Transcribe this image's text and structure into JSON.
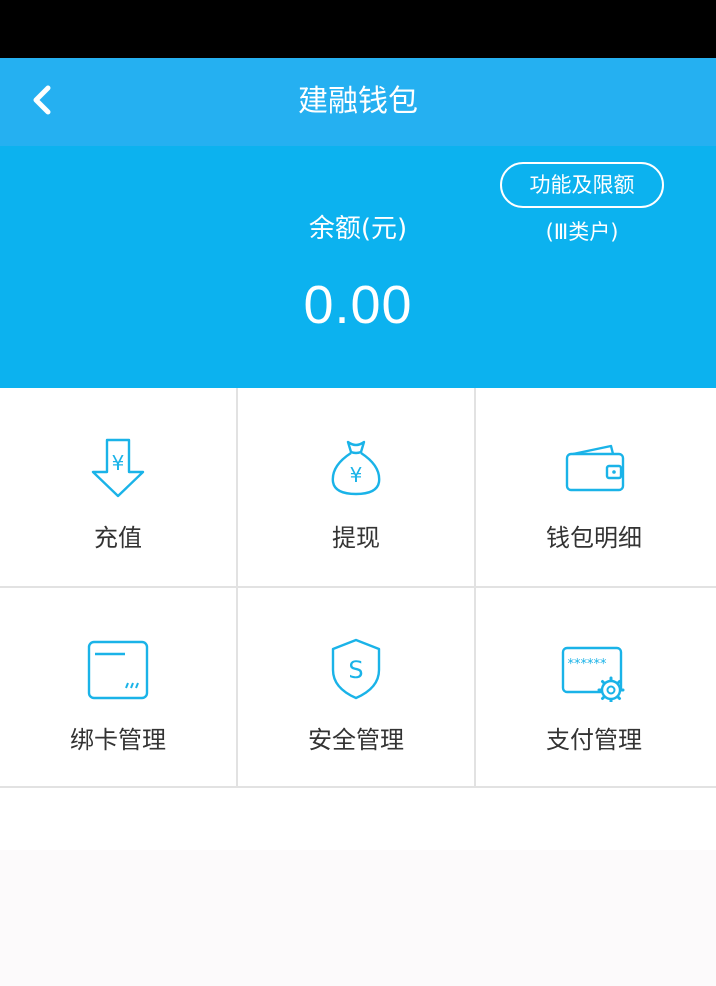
{
  "nav": {
    "title": "建融钱包"
  },
  "balance": {
    "limit_button": "功能及限额",
    "account_type": "(Ⅲ类户)",
    "label": "余额(元)",
    "value": "0.00"
  },
  "menu": [
    {
      "label": "充值",
      "icon": "recharge-icon"
    },
    {
      "label": "提现",
      "icon": "withdraw-icon"
    },
    {
      "label": "钱包明细",
      "icon": "wallet-icon"
    },
    {
      "label": "绑卡管理",
      "icon": "card-icon"
    },
    {
      "label": "安全管理",
      "icon": "shield-icon"
    },
    {
      "label": "支付管理",
      "icon": "payment-settings-icon"
    }
  ],
  "colors": {
    "nav": "#25b0f1",
    "panel": "#0cb2ef",
    "icon": "#1ab3e8"
  }
}
